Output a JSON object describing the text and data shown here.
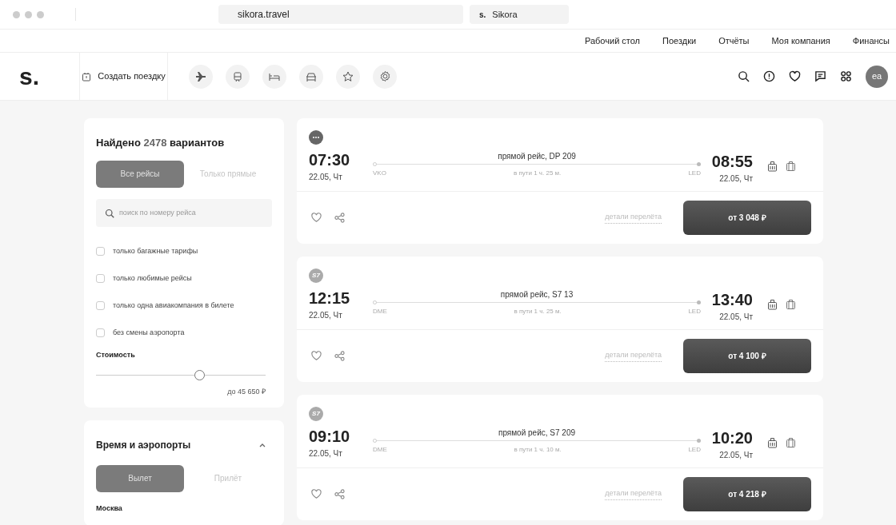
{
  "browser": {
    "address": "sikora.travel",
    "tab": "Sikora",
    "tab_logo": "s."
  },
  "top_nav": [
    "Рабочий стол",
    "Поездки",
    "Отчёты",
    "Моя компания",
    "Финансы"
  ],
  "header": {
    "logo": "s.",
    "create_trip": "Создать поездку",
    "avatar": "ea"
  },
  "filters": {
    "found": "Найдено **2478** вариантов",
    "flight_toggle": [
      {
        "label": "Все рейсы",
        "selected": true
      },
      {
        "label": "Только прямые",
        "selected": false
      }
    ],
    "search": {
      "placeholder": "поиск по номеру рейса"
    },
    "checkboxes": [
      {
        "label": "только багажные тарифы",
        "checked": false
      },
      {
        "label": "только любимые рейсы",
        "checked": false
      },
      {
        "label": "только одна авиакомпания в билете",
        "checked": false
      },
      {
        "label": "без смены аэропорта",
        "checked": false
      }
    ],
    "price": {
      "title": "Стоимость",
      "level": 0.62,
      "reading": "до 45 650 ₽"
    }
  },
  "time_airports": {
    "title": "Время и аэропорты",
    "expanded": true,
    "toggle": [
      {
        "label": "Вылет",
        "selected": true
      },
      {
        "label": "Прилёт",
        "selected": false
      }
    ],
    "city": "Москва"
  },
  "flights": [
    {
      "logo": {
        "kind": "dots"
      },
      "dep_time": "07:30",
      "dep_date": "22.05, Чт",
      "route": "прямой рейс, DP 209",
      "from": "VKO",
      "duration": "в пути 1 ч. 25 м.",
      "to": "LED",
      "arr_time": "08:55",
      "arr_date": "22.05, Чт",
      "details": "детали перелёта",
      "price": "от 3 048 ₽"
    },
    {
      "logo": {
        "kind": "text",
        "text": "S7"
      },
      "dep_time": "12:15",
      "dep_date": "22.05, Чт",
      "route": "прямой рейс, S7 13",
      "from": "DME",
      "duration": "в пути 1 ч. 25 м.",
      "to": "LED",
      "arr_time": "13:40",
      "arr_date": "22.05, Чт",
      "details": "детали перелёта",
      "price": "от 4 100 ₽"
    },
    {
      "logo": {
        "kind": "text",
        "text": "S7"
      },
      "dep_time": "09:10",
      "dep_date": "22.05, Чт",
      "route": "прямой рейс, S7 209",
      "from": "DME",
      "duration": "в пути 1 ч. 10 м.",
      "to": "LED",
      "arr_time": "10:20",
      "arr_date": "22.05, Чт",
      "details": "детали перелёта",
      "price": "от 4 218 ₽"
    }
  ]
}
